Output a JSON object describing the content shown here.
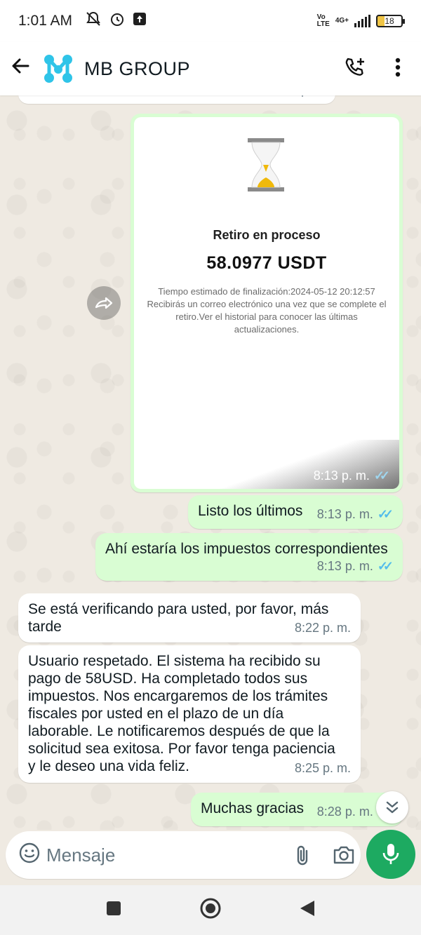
{
  "status_bar": {
    "time": "1:01 AM",
    "network_top": "Vo",
    "network_bottom": "LTE",
    "network_gen": "4G+",
    "battery": "18"
  },
  "app_bar": {
    "title": "MB GROUP"
  },
  "chat": {
    "image_message": {
      "title": "Retiro en proceso",
      "amount": "58.0977 USDT",
      "info_line1": "Tiempo estimado de finalización:2024-05-12 20:12:57",
      "info_line2": "Recibirás un correo electrónico una vez que se complete el retiro.Ver el historial para conocer las últimas actualizaciones.",
      "time": "8:13 p. m."
    },
    "messages": [
      {
        "text": "Listo los últimos",
        "time": "8:13 p. m."
      },
      {
        "text": "Ahí estaría los impuestos correspondientes",
        "time": "8:13 p. m."
      },
      {
        "text": "Se está verificando para usted, por favor, más tarde",
        "time": "8:22 p. m."
      },
      {
        "text": "Usuario respetado. El sistema ha recibido su pago de 58USD. Ha completado todos sus impuestos. Nos encargaremos de los trámites fiscales por usted en el plazo de un día laborable. Le notificaremos después de que la solicitud sea exitosa. Por favor tenga paciencia y le deseo una vida feliz.",
        "time": "8:25 p. m."
      },
      {
        "text": "Muchas gracias",
        "time": "8:28 p. m."
      }
    ]
  },
  "composer": {
    "placeholder": "Mensaje"
  },
  "colors": {
    "outgoing_bubble": "#d9fdd3",
    "incoming_bubble": "#ffffff",
    "chat_background": "#efeae2",
    "read_ticks": "#53bdeb",
    "mic_button": "#1daa61"
  }
}
